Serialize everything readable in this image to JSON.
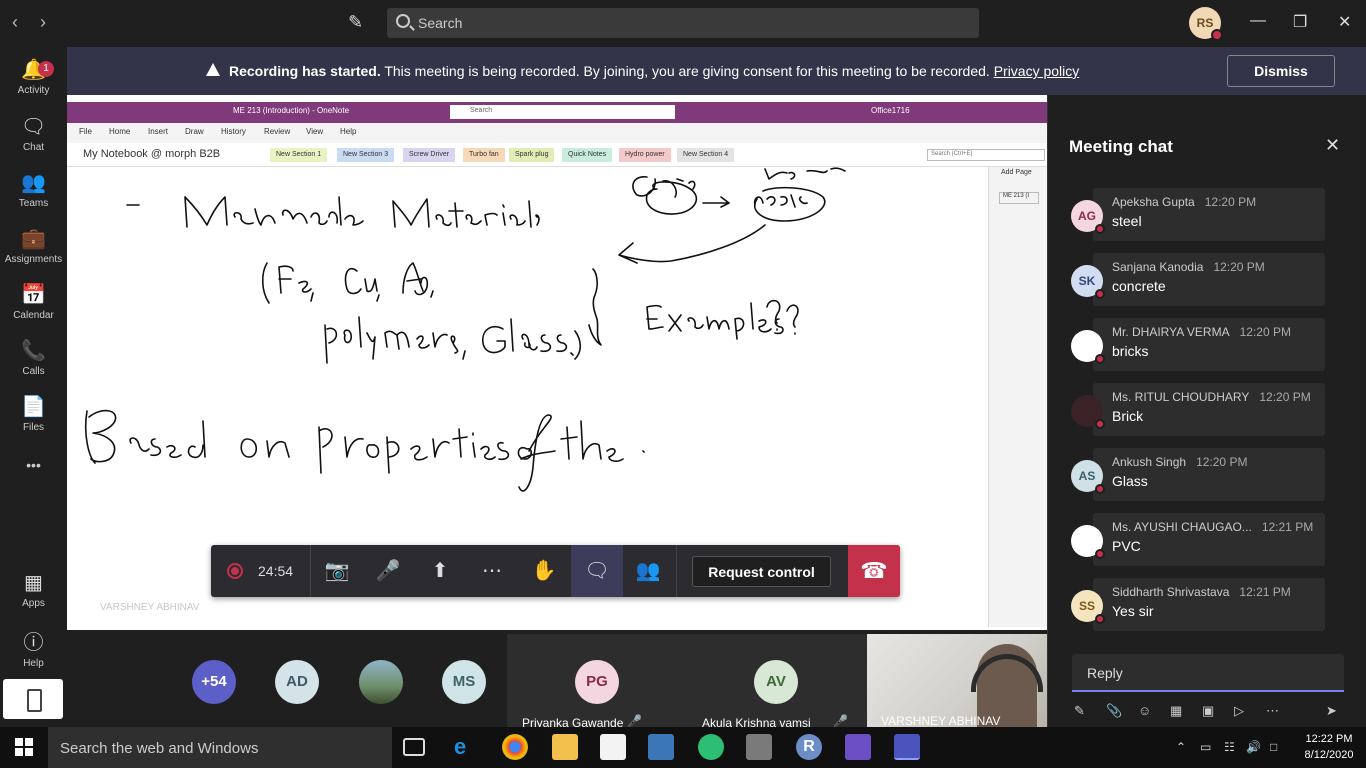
{
  "titlebar": {
    "search_placeholder": "Search",
    "user_initials": "RS"
  },
  "rail": {
    "activity": {
      "label": "Activity",
      "badge": "1"
    },
    "chat": "Chat",
    "teams": "Teams",
    "assignments": "Assignments",
    "calendar": "Calendar",
    "calls": "Calls",
    "files": "Files",
    "more": "•••",
    "apps": "Apps",
    "help": "Help"
  },
  "banner": {
    "bold": "Recording has started.",
    "text": " This meeting is being recorded. By joining, you are giving consent for this meeting to be recorded. ",
    "link": "Privacy policy",
    "dismiss": "Dismiss"
  },
  "onenote": {
    "title": "ME 213 (Introduction)  -  OneNote",
    "search": "Search",
    "user": "Office1716",
    "menu": [
      "File",
      "Home",
      "Insert",
      "Draw",
      "History",
      "Review",
      "View",
      "Help"
    ],
    "notebook": "My Notebook @ morph B2B",
    "tabs": [
      {
        "label": "New Section 1",
        "color": "#e8f3c2"
      },
      {
        "label": "New Section 3",
        "color": "#c9dcf3"
      },
      {
        "label": "Screw Driver",
        "color": "#d9d4ef"
      },
      {
        "label": "Turbo fan",
        "color": "#f6d9b8"
      },
      {
        "label": "Spark plug",
        "color": "#e2ecb5"
      },
      {
        "label": "Quick Notes",
        "color": "#c9ecdd"
      },
      {
        "label": "Hydro power",
        "color": "#f4c9c9"
      },
      {
        "label": "New Section 4",
        "color": "#e3e3e3"
      }
    ],
    "search_box": "Search (Ctrl+E)",
    "add_page": "Add Page",
    "page_item": "ME 213 (I",
    "presenter_label": "VARSHNEY ABHINAV"
  },
  "controls": {
    "timer": "24:54",
    "request_control": "Request control"
  },
  "participants": {
    "overflow": "+54",
    "avatars": [
      {
        "initials": "AD",
        "bg": "#d4e3e8",
        "fg": "#3f5a65"
      },
      {
        "initials": "MS",
        "bg": "#cfe4e6",
        "fg": "#3f6266"
      }
    ],
    "tiles": [
      {
        "initials": "PG",
        "name": "Priyanka Gawande",
        "bg": "#f3d6e0",
        "fg": "#8a2b4a"
      },
      {
        "initials": "AV",
        "name": "Akula Krishna vamsi",
        "bg": "#d7e9d4",
        "fg": "#3d6937"
      }
    ],
    "video_name": "VARSHNEY ABHINAV"
  },
  "chat": {
    "title": "Meeting chat",
    "messages": [
      {
        "initials": "AG",
        "name": "Apeksha Gupta",
        "time": "12:20 PM",
        "text": "steel",
        "bg": "#f3d6e0",
        "fg": "#8a2b4a"
      },
      {
        "initials": "SK",
        "name": "Sanjana Kanodia",
        "time": "12:20 PM",
        "text": "concrete",
        "bg": "#d2ddf2",
        "fg": "#2f4a7a"
      },
      {
        "initials": "",
        "name": "Mr. DHAIRYA VERMA",
        "time": "12:20 PM",
        "text": "bricks",
        "bg": "#ffffff",
        "fg": "#333333"
      },
      {
        "initials": "",
        "name": "Ms. RITUL CHOUDHARY",
        "time": "12:20 PM",
        "text": "Brick",
        "bg": "#3a2226",
        "fg": "#ffffff"
      },
      {
        "initials": "AS",
        "name": "Ankush Singh",
        "time": "12:20 PM",
        "text": "Glass",
        "bg": "#cfe1e6",
        "fg": "#3d5f68"
      },
      {
        "initials": "",
        "name": "Ms. AYUSHI CHAUGAO...",
        "time": "12:21 PM",
        "text": "PVC",
        "bg": "#ffffff",
        "fg": "#e07b00"
      },
      {
        "initials": "SS",
        "name": "Siddharth Shrivastava",
        "time": "12:21 PM",
        "text": "Yes sir",
        "bg": "#f4e5c0",
        "fg": "#7a5a12"
      }
    ],
    "reply_placeholder": "Reply"
  },
  "taskbar": {
    "search": "Search the web and Windows",
    "time": "12:22 PM",
    "date": "8/12/2020"
  },
  "colors": {
    "accent": "#7b83eb",
    "banner": "#33344a",
    "hangup": "#c4314b",
    "onenote": "#80397b"
  }
}
